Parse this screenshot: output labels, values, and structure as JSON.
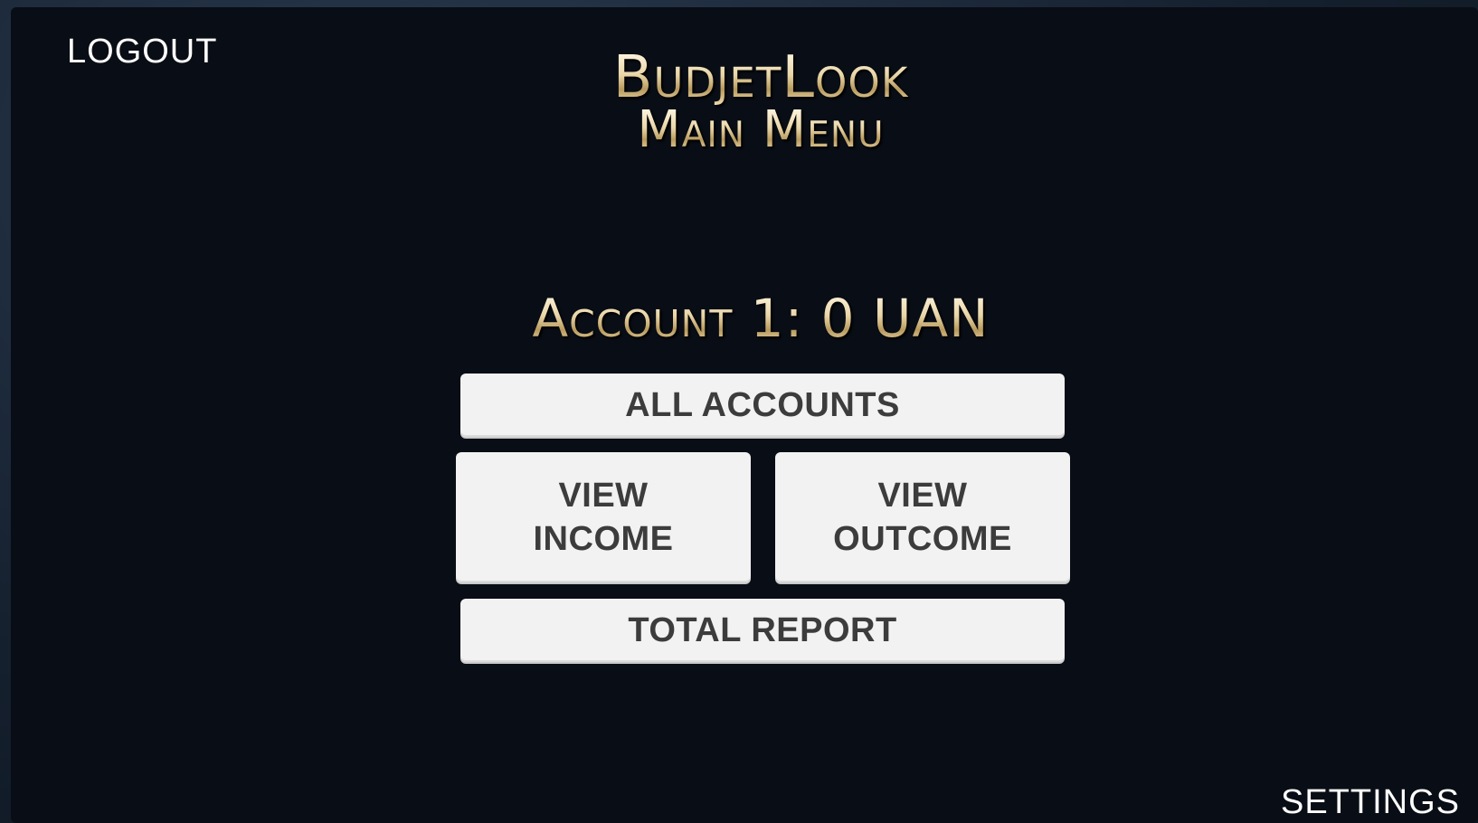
{
  "header": {
    "logout_label": "LOGOUT",
    "app_title": "BudjetLook",
    "menu_title": "Main Menu"
  },
  "account": {
    "label": "Account 1: 0 UAN"
  },
  "menu": {
    "all_accounts": "ALL ACCOUNTS",
    "view_income_line1": "VIEW",
    "view_income_line2": "INCOME",
    "view_outcome_line1": "VIEW",
    "view_outcome_line2": "OUTCOME",
    "total_report": "TOTAL REPORT"
  },
  "footer": {
    "settings_label": "SETTINGS"
  },
  "colors": {
    "background": "#090d15",
    "button_face": "#f2f2f2",
    "button_text": "#3c3c3c",
    "title_gold": "#e9d6a8"
  }
}
